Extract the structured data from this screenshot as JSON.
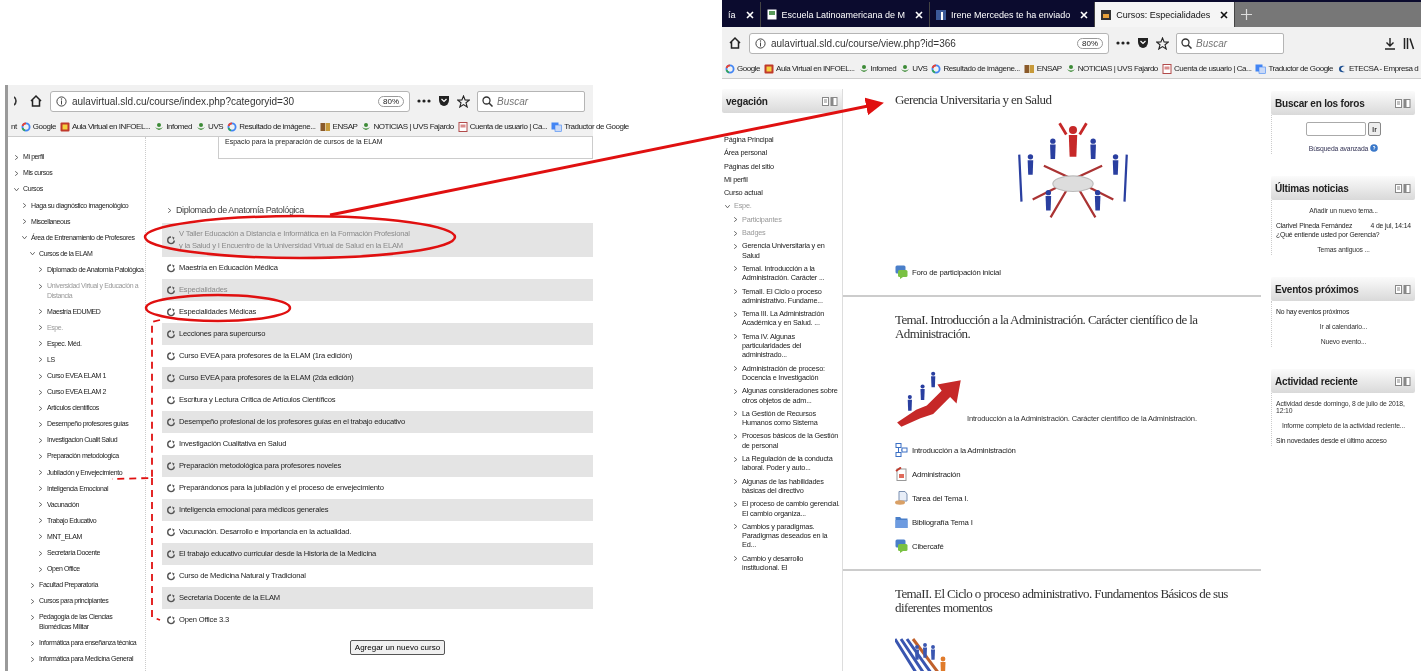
{
  "left_window": {
    "toolbar": {
      "url": "aulavirtual.sld.cu/course/index.php?categoryid=30",
      "zoom": "80%",
      "search_placeholder": "Buscar"
    },
    "bookmarks": [
      {
        "label": "nt",
        "kind": "none"
      },
      {
        "label": "Google",
        "kind": "ring"
      },
      {
        "label": "Aula Virtual en INFOEL...",
        "kind": "app"
      },
      {
        "label": "Infomed",
        "kind": "leaf"
      },
      {
        "label": "UVS",
        "kind": "leaf"
      },
      {
        "label": "Resultado de imágene...",
        "kind": "ring"
      },
      {
        "label": "ENSAP",
        "kind": "book"
      },
      {
        "label": "NOTICIAS | UVS Fajardo",
        "kind": "leaf"
      },
      {
        "label": "Cuenta de usuario | Ca...",
        "kind": "page"
      },
      {
        "label": "Traductor de Google",
        "kind": "translate"
      }
    ],
    "sidebar": [
      {
        "label": "Mi perfil",
        "expanded": false,
        "dimmed": false
      },
      {
        "label": "Mis cursos",
        "expanded": false,
        "dimmed": false
      },
      {
        "label": "Cursos",
        "expanded": true,
        "dimmed": false,
        "children": [
          {
            "label": "Haga su diagnóstico imagenológico",
            "expanded": false,
            "dimmed": false
          },
          {
            "label": "Miscellaneous",
            "expanded": false,
            "dimmed": false
          },
          {
            "label": "Área de Entrenamiento de Profesores",
            "expanded": true,
            "dimmed": false,
            "children": [
              {
                "label": "Cursos de la ELAM",
                "expanded": true,
                "dimmed": false,
                "children": [
                  {
                    "label": "Diplomado de Anatomía Patológica",
                    "expanded": false,
                    "dimmed": false
                  },
                  {
                    "label": "Universidad Virtual y Educación a Distancia",
                    "expanded": false,
                    "dimmed": true
                  },
                  {
                    "label": "Maestría EDUMED",
                    "expanded": false,
                    "dimmed": false
                  },
                  {
                    "label": "Espe.",
                    "expanded": false,
                    "dimmed": true
                  },
                  {
                    "label": "Espec. Méd.",
                    "expanded": false,
                    "dimmed": false
                  },
                  {
                    "label": "LS",
                    "expanded": false,
                    "dimmed": false
                  },
                  {
                    "label": "Curso EVEA ELAM 1",
                    "expanded": false,
                    "dimmed": false
                  },
                  {
                    "label": "Curso EVEA ELAM 2",
                    "expanded": false,
                    "dimmed": false
                  },
                  {
                    "label": "Artículos científicos",
                    "expanded": false,
                    "dimmed": false
                  },
                  {
                    "label": "Desempeño profesores guías",
                    "expanded": false,
                    "dimmed": false
                  },
                  {
                    "label": "Investigacion Cualit Salud",
                    "expanded": false,
                    "dimmed": false
                  },
                  {
                    "label": "Preparación metodologica",
                    "expanded": false,
                    "dimmed": false
                  },
                  {
                    "label": "Jubilación y Envejecimiento",
                    "expanded": false,
                    "dimmed": false
                  },
                  {
                    "label": "Inteligencia Emocional",
                    "expanded": false,
                    "dimmed": false
                  },
                  {
                    "label": "Vacunación",
                    "expanded": false,
                    "dimmed": false
                  },
                  {
                    "label": "Trabajo Educativo",
                    "expanded": false,
                    "dimmed": false
                  },
                  {
                    "label": "MNT_ELAM",
                    "expanded": false,
                    "dimmed": false
                  },
                  {
                    "label": "Secretaría Docente",
                    "expanded": false,
                    "dimmed": false
                  },
                  {
                    "label": "Open Office",
                    "expanded": false,
                    "dimmed": false
                  }
                ]
              },
              {
                "label": "Facultad Preparatoria",
                "expanded": false,
                "dimmed": false
              },
              {
                "label": "Cursos para principiantes",
                "expanded": false,
                "dimmed": false
              },
              {
                "label": "Pedagogía de las Ciencias Biomédicas Militar",
                "expanded": false,
                "dimmed": false
              },
              {
                "label": "Informática para enseñanza técnica",
                "expanded": false,
                "dimmed": false
              },
              {
                "label": "Informática para Medicina General",
                "expanded": false,
                "dimmed": false
              }
            ]
          }
        ]
      }
    ],
    "main": {
      "description": "Espacio para la preparación de cursos de la ELAM",
      "category": "Diplomado de Anatomía Patológica",
      "courses": [
        {
          "name": "V Taller Educación a Distancia e Informática en la Formación Profesional y la Salud y I Encuentro de la Universidad Virtual de Salud en la ELAM",
          "dimmed": true
        },
        {
          "name": "Maestría en Educación Médica",
          "dimmed": false
        },
        {
          "name": "Especialidades",
          "dimmed": true
        },
        {
          "name": "Especialidades Médicas",
          "dimmed": false
        },
        {
          "name": "Lecciones para supercurso",
          "dimmed": false
        },
        {
          "name": "Curso EVEA para profesores de la ELAM (1ra edición)",
          "dimmed": false
        },
        {
          "name": "Curso EVEA para profesores de la ELAM (2da edición)",
          "dimmed": false
        },
        {
          "name": "Escritura y Lectura Crítica de Artículos Científicos",
          "dimmed": false
        },
        {
          "name": "Desempeño profesional de los profesores guías en el trabajo educativo",
          "dimmed": false
        },
        {
          "name": "Investigación Cualitativa en Salud",
          "dimmed": false
        },
        {
          "name": "Preparación metodológica para profesores noveles",
          "dimmed": false
        },
        {
          "name": "Preparándonos para la jubilación y el proceso de envejecimiento",
          "dimmed": false
        },
        {
          "name": "Inteligencia emocional para médicos generales",
          "dimmed": false
        },
        {
          "name": "Vacunación. Desarrollo e importancia en la actualidad.",
          "dimmed": false
        },
        {
          "name": "El trabajo educativo curricular desde la Historia de la Medicina",
          "dimmed": false
        },
        {
          "name": "Curso de Medicina Natural y Tradicional",
          "dimmed": false
        },
        {
          "name": "Secretaría Docente de la ELAM",
          "dimmed": false
        },
        {
          "name": "Open Office 3.3",
          "dimmed": false
        }
      ],
      "add_button": "Agregar un nuevo curso"
    }
  },
  "right_window": {
    "tabs": [
      {
        "title": "ía",
        "selected": false
      },
      {
        "title": "Escuela Latinoamericana de M",
        "selected": false
      },
      {
        "title": "Irene Mercedes te ha enviado",
        "selected": false
      },
      {
        "title": "Cursos: Especialidades",
        "selected": true
      }
    ],
    "toolbar": {
      "url": "aulavirtual.sld.cu/course/view.php?id=366",
      "zoom": "80%",
      "search_placeholder": "Buscar"
    },
    "bookmarks": [
      {
        "label": "Google",
        "kind": "ring"
      },
      {
        "label": "Aula Virtual en INFOEL...",
        "kind": "app"
      },
      {
        "label": "Infomed",
        "kind": "leaf"
      },
      {
        "label": "UVS",
        "kind": "leaf"
      },
      {
        "label": "Resultado de imágene...",
        "kind": "ring"
      },
      {
        "label": "ENSAP",
        "kind": "book"
      },
      {
        "label": "NOTICIAS | UVS Fajardo",
        "kind": "leaf"
      },
      {
        "label": "Cuenta de usuario | Ca...",
        "kind": "page"
      },
      {
        "label": "Traductor de Google",
        "kind": "translate"
      },
      {
        "label": "ETECSA - Empresa d",
        "kind": "swirl"
      }
    ],
    "navigation": {
      "title": "vegación",
      "items": [
        {
          "label": "Página Principal"
        },
        {
          "label": "Área personal"
        },
        {
          "label": "Páginas del sitio"
        },
        {
          "label": "Mi perfil"
        },
        {
          "label": "Curso actual"
        },
        {
          "label": "Espe.",
          "expanded": true,
          "dimmed": true,
          "children": [
            {
              "label": "Participantes",
              "expanded": false,
              "dimmed": true
            },
            {
              "label": "Badges",
              "expanded": false,
              "dimmed": true
            },
            {
              "label": "Gerencia Universitaria y en Salud",
              "expanded": false,
              "dimmed": false
            },
            {
              "label": "TemaI. Introducción a la Administración. Carácter ...",
              "expanded": false,
              "dimmed": false
            },
            {
              "label": "TemaII. El Ciclo o proceso administrativo. Fundame...",
              "expanded": false,
              "dimmed": false
            },
            {
              "label": "Tema III. La Administración Académica y en Salud. ...",
              "expanded": false,
              "dimmed": false
            },
            {
              "label": "Tema IV. Algunas particularidades del administrado...",
              "expanded": false,
              "dimmed": false
            },
            {
              "label": "Administración de proceso: Docencia e Investigación",
              "expanded": false,
              "dimmed": false
            },
            {
              "label": "Algunas consideraciones sobre otros objetos de adm...",
              "expanded": false,
              "dimmed": false
            },
            {
              "label": "La Gestión de Recursos Humanos como Sistema",
              "expanded": false,
              "dimmed": false
            },
            {
              "label": "Procesos básicos de la Gestión de personal",
              "expanded": false,
              "dimmed": false
            },
            {
              "label": "La Regulación de la conducta laboral. Poder y auto...",
              "expanded": false,
              "dimmed": false
            },
            {
              "label": "Algunas de las habilidades básicas del directivo",
              "expanded": false,
              "dimmed": false
            },
            {
              "label": "El proceso de cambio gerencial. El cambio organiza...",
              "expanded": false,
              "dimmed": false
            },
            {
              "label": "Cambios y paradigmas. Paradigmas deseados en la Ed...",
              "expanded": false,
              "dimmed": false
            },
            {
              "label": "Cambio y desarrollo institucional. El",
              "expanded": false,
              "dimmed": false
            }
          ]
        }
      ]
    },
    "sections": [
      {
        "title": "Gerencia Universitaria y en Salud",
        "activities": [
          {
            "name": "Foro de participación inicial",
            "kind": "forum"
          }
        ]
      },
      {
        "title": "TemaI. Introducción a la Administración. Carácter científico de la Administración.",
        "summary": "Introducción a la Administración. Carácter científico de la Administración.",
        "activities": [
          {
            "name": "Introducción a la Administración",
            "kind": "lesson"
          },
          {
            "name": "Administración",
            "kind": "file"
          },
          {
            "name": "Tarea del Tema I.",
            "kind": "assign"
          },
          {
            "name": "Bibliografía Tema I",
            "kind": "folder"
          },
          {
            "name": "Cibercafé",
            "kind": "chat"
          }
        ]
      },
      {
        "title": "TemaII. El Ciclo o proceso administrativo. Fundamentos Básicos de sus diferentes momentos"
      }
    ],
    "blocks": [
      {
        "title": "Buscar en los foros",
        "content": [
          {
            "kind": "search-form",
            "text": "Ir"
          },
          {
            "kind": "help-link",
            "text": "Búsqueda avanzada"
          }
        ]
      },
      {
        "title": "Últimas noticias",
        "content": [
          {
            "kind": "link",
            "text": "Añadir un nuevo tema..."
          },
          {
            "kind": "post",
            "author": "Clarivel Pineda Fernández",
            "date": "4 de jul, 14:14",
            "text": "¿Qué entiende usted por Gerencia?"
          },
          {
            "kind": "link",
            "text": "Temas antiguos ..."
          }
        ]
      },
      {
        "title": "Eventos próximos",
        "content": [
          {
            "kind": "text",
            "text": "No hay eventos próximos"
          },
          {
            "kind": "link",
            "text": "Ir al calendario..."
          },
          {
            "kind": "link",
            "text": "Nuevo evento..."
          }
        ]
      },
      {
        "title": "Actividad reciente",
        "content": [
          {
            "kind": "link",
            "text": "Actividad desde domingo, 8 de julio de 2018, 12:10"
          },
          {
            "kind": "link",
            "text": "Informe completo de la actividad reciente..."
          },
          {
            "kind": "text",
            "text": "Sin novedades desde el último acceso"
          }
        ]
      }
    ]
  }
}
